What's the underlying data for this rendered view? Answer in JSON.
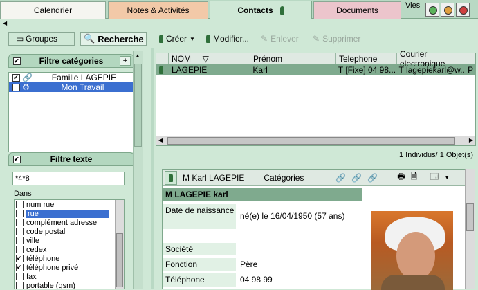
{
  "tabs": [
    {
      "label": "Calendrier"
    },
    {
      "label": "Notes & Activités"
    },
    {
      "label": "Contacts"
    },
    {
      "label": "Documents"
    }
  ],
  "vies": "Vies",
  "toolbar": {
    "groupes": "Groupes",
    "recherche": "Recherche",
    "creer": "Créer",
    "modifier": "Modifier...",
    "enlever": "Enlever",
    "supprimer": "Supprimer"
  },
  "filtre_categories": {
    "title": "Filtre catégories",
    "items": [
      {
        "label": "Famille LAGEPIE",
        "checked": true
      },
      {
        "label": "Mon Travail",
        "checked": true
      }
    ]
  },
  "filtre_texte": {
    "title": "Filtre texte",
    "value": "*4*8",
    "dans": "Dans",
    "fields": [
      {
        "label": "num rue",
        "checked": false
      },
      {
        "label": "rue",
        "checked": false
      },
      {
        "label": "complément adresse",
        "checked": false
      },
      {
        "label": "code postal",
        "checked": false
      },
      {
        "label": "ville",
        "checked": false
      },
      {
        "label": "cedex",
        "checked": false
      },
      {
        "label": "téléphone",
        "checked": true
      },
      {
        "label": "téléphone privé",
        "checked": true
      },
      {
        "label": "fax",
        "checked": false
      },
      {
        "label": "portable (gsm)",
        "checked": false
      }
    ]
  },
  "grid": {
    "columns": [
      "NOM",
      "Prénom",
      "Telephone",
      "Courier electronique"
    ],
    "rows": [
      {
        "nom": "LAGEPIE",
        "prenom": "Karl",
        "telephone": "T [Fixe] 04 98...",
        "email": "T lagepiekarl@w...",
        "extra": "P"
      }
    ],
    "count": "1 Individus/ 1 Objet(s)"
  },
  "detail": {
    "header_name": "M Karl LAGEPIE",
    "categories": "Catégories",
    "full_name": "M LAGEPIE karl",
    "fields": [
      {
        "label": "Date de naissance",
        "value": "né(e) le 16/04/1950 (57 ans)"
      },
      {
        "label": "Société",
        "value": ""
      },
      {
        "label": "Fonction",
        "value": "Père"
      },
      {
        "label": "Téléphone",
        "value": "04 98 99"
      }
    ]
  }
}
